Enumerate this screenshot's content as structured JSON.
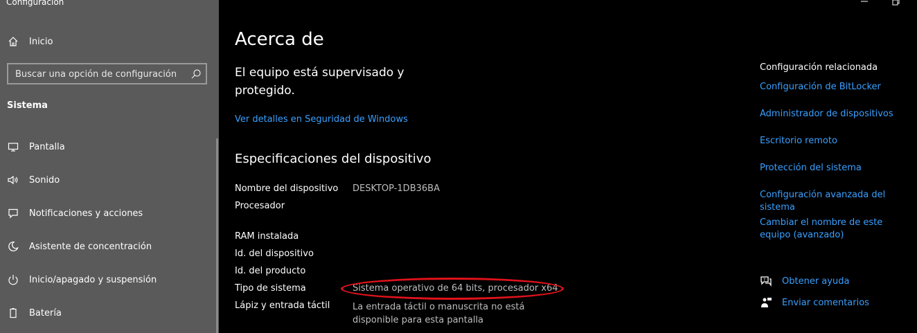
{
  "window": {
    "title": "Configuración"
  },
  "sidebar": {
    "home_label": "Inicio",
    "search_placeholder": "Buscar una opción de configuración",
    "section": "Sistema",
    "items": [
      {
        "label": "Pantalla",
        "icon": "monitor-icon"
      },
      {
        "label": "Sonido",
        "icon": "speaker-icon"
      },
      {
        "label": "Notificaciones y acciones",
        "icon": "notification-icon"
      },
      {
        "label": "Asistente de concentración",
        "icon": "moon-icon"
      },
      {
        "label": "Inicio/apagado y suspensión",
        "icon": "power-icon"
      },
      {
        "label": "Batería",
        "icon": "battery-icon"
      }
    ]
  },
  "main": {
    "title": "Acerca de",
    "status": "El equipo está supervisado y protegido.",
    "security_link": "Ver detalles en Seguridad de Windows",
    "spec_heading": "Especificaciones del dispositivo",
    "specs": [
      {
        "label": "Nombre del dispositivo",
        "value": "DESKTOP-1DB36BA"
      },
      {
        "label": "Procesador",
        "value": ""
      },
      {
        "label": "RAM instalada",
        "value": ""
      },
      {
        "label": "Id. del dispositivo",
        "value": ""
      },
      {
        "label": "Id. del producto",
        "value": ""
      },
      {
        "label": "Tipo de sistema",
        "value": "Sistema operativo de 64 bits, procesador x64"
      },
      {
        "label": "Lápiz y entrada táctil",
        "value": "La entrada táctil o manuscrita no está disponible para esta pantalla"
      }
    ]
  },
  "related": {
    "title": "Configuración relacionada",
    "links": [
      "Configuración de BitLocker",
      "Administrador de dispositivos",
      "Escritorio remoto",
      "Protección del sistema",
      "Configuración avanzada del sistema",
      "Cambiar el nombre de este equipo (avanzado)"
    ],
    "help": [
      {
        "label": "Obtener ayuda",
        "icon": "help-chat-icon"
      },
      {
        "label": "Enviar comentarios",
        "icon": "feedback-icon"
      }
    ]
  },
  "colors": {
    "accent": "#3aa0ff",
    "highlight": "#e0121b",
    "sidebar_bg": "#5a5a5a"
  }
}
